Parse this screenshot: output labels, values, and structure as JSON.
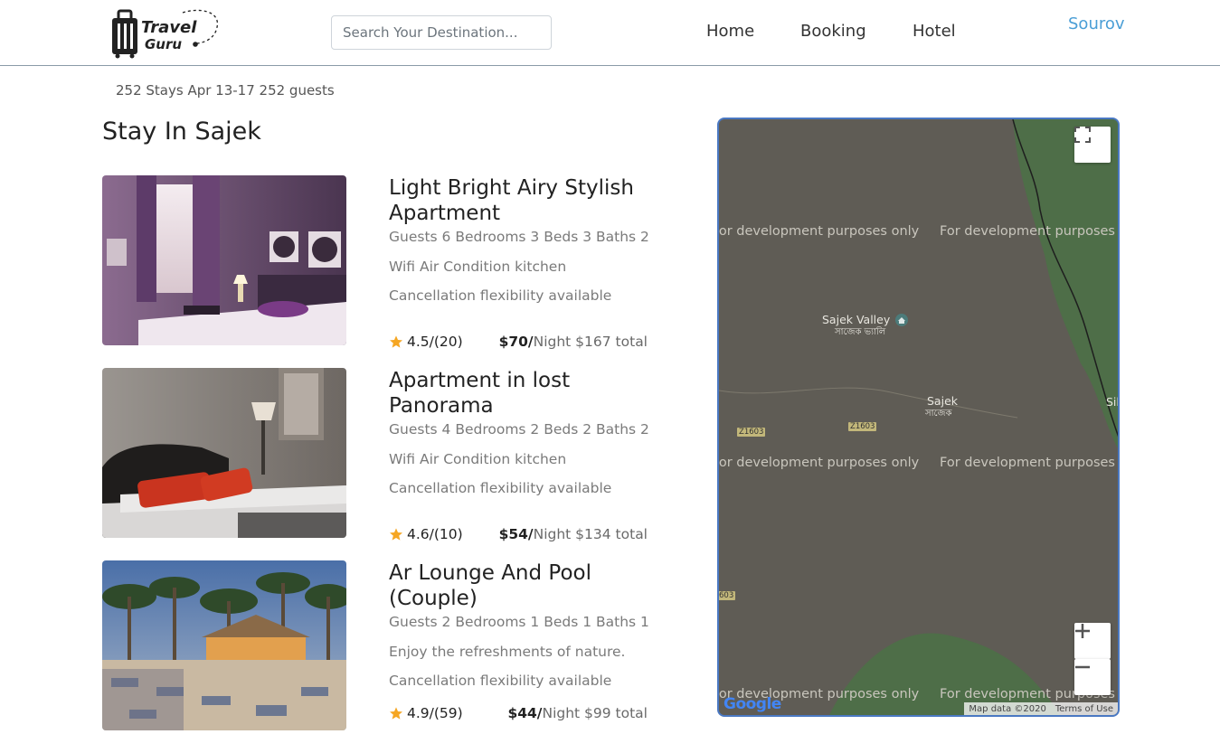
{
  "app": {
    "logo_line1": "Travel",
    "logo_line2": "Guru"
  },
  "header": {
    "search_placeholder": "Search Your Destination...",
    "nav": [
      "Home",
      "Booking",
      "Hotel"
    ],
    "user": "Sourov"
  },
  "summary": "252 Stays Apr 13-17 252 guests",
  "page_title": "Stay In Sajek",
  "listings": [
    {
      "title": "Light Bright Airy Stylish Apartment",
      "meta": "Guests 6 Bedrooms 3 Beds 3 Baths 2",
      "amenities": "Wifi Air Condition kitchen",
      "policy": "Cancellation flexibility available",
      "rating": "4.5/(20)",
      "price": "$70/",
      "price_rest": "Night $167 total",
      "photo": "bedroom-purple"
    },
    {
      "title": "Apartment in lost Panorama",
      "meta": "Guests 4 Bedrooms 2 Beds 2 Baths 2",
      "amenities": "Wifi Air Condition kitchen",
      "policy": "Cancellation flexibility available",
      "rating": "4.6/(10)",
      "price": "$54/",
      "price_rest": "Night $134 total",
      "photo": "bedroom-red-pillows"
    },
    {
      "title": "Ar Lounge And Pool (Couple)",
      "meta": "Guests 2 Bedrooms 1 Beds 1 Baths 1",
      "amenities": "Enjoy the refreshments of nature.",
      "policy": "Cancellation flexibility available",
      "rating": "4.9/(59)",
      "price": "$44/",
      "price_rest": "Night $99 total",
      "photo": "beach-lounge"
    }
  ],
  "map": {
    "watermark": "For development purposes only",
    "place1": "Sajek Valley",
    "place1_local": "সাজেক ভ্যালি",
    "place2": "Sajek",
    "place2_local": "সাজেক",
    "edge_label": "Sil",
    "road1": "Z1603",
    "road2": "Z1603",
    "road3": "603",
    "attribution_data": "Map data ©2020",
    "attribution_terms": "Terms of Use",
    "google": "Google",
    "colors": {
      "land": "#5f5c55",
      "forest": "#4e6e48"
    }
  }
}
